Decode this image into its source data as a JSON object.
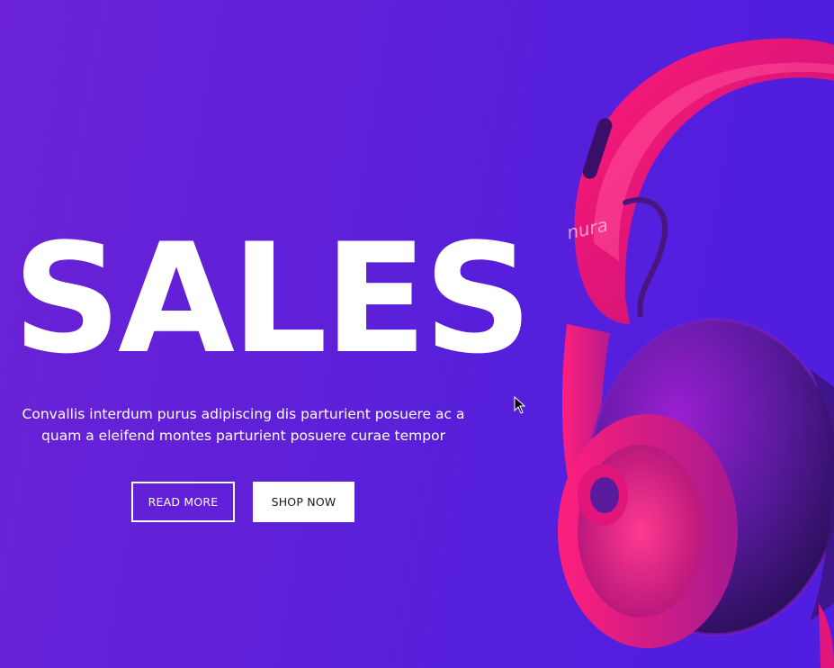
{
  "hero": {
    "headline": "SALES",
    "description": "Convallis interdum purus adipiscing dis parturient posuere ac a quam a eleifend montes parturient posuere curae tempor",
    "read_more_label": "READ MORE",
    "shop_now_label": "SHOP NOW"
  },
  "product": {
    "brand": "nura",
    "icon": "headphones-image"
  },
  "colors": {
    "background_start": "#6b22d6",
    "background_end": "#4f1ee0",
    "headphone_pink": "#e0167a",
    "text": "#ffffff"
  }
}
